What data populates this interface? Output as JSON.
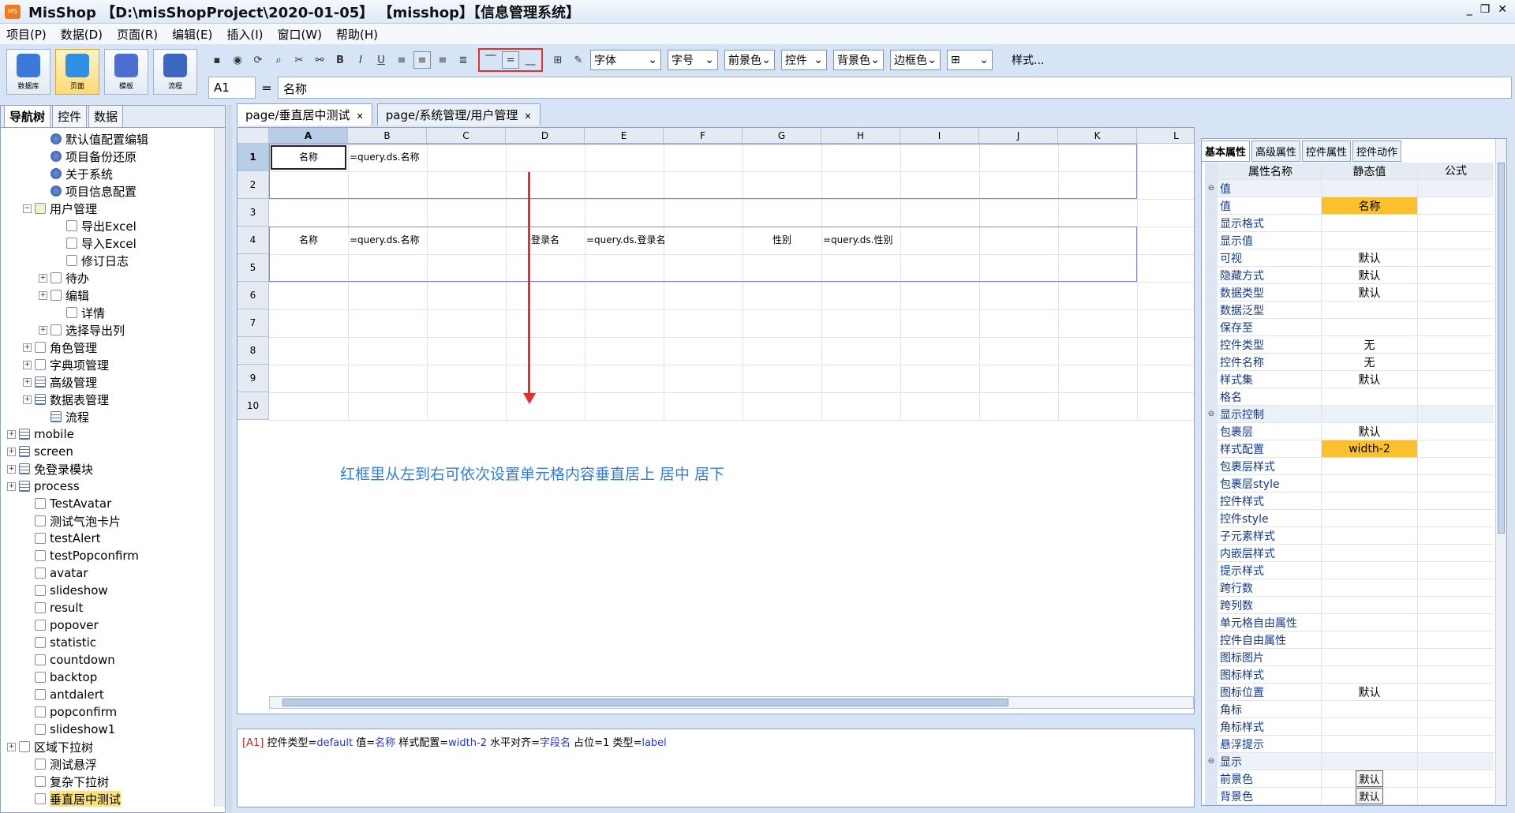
{
  "app": {
    "title": "MisShop 【D:\\misShopProject\\2020-01-05】 【misshop】【信息管理系统】",
    "min": "_",
    "max": "❐",
    "close": "✕"
  },
  "menu": [
    "项目(P)",
    "数据(D)",
    "页面(R)",
    "编辑(E)",
    "插入(I)",
    "窗口(W)",
    "帮助(H)"
  ],
  "bigbuttons": [
    {
      "label": "数据库",
      "color": "#3b7ad8"
    },
    {
      "label": "页面",
      "color": "#2f8fe0"
    },
    {
      "label": "模板",
      "color": "#4a6fd0"
    },
    {
      "label": "流程",
      "color": "#3a67c0"
    }
  ],
  "toolbar": {
    "font": "字体",
    "size": "字号",
    "fg": "前景色",
    "ctrl": "控件",
    "bg": "背景色",
    "border": "边框色",
    "style_label": "样式..."
  },
  "formula": {
    "cell": "A1",
    "eq": "=",
    "value": "名称"
  },
  "left_tabs": [
    "导航树",
    "控件",
    "数据"
  ],
  "tree": [
    {
      "indent": 2,
      "icon": "gear",
      "label": "默认值配置编辑",
      "tog": ""
    },
    {
      "indent": 2,
      "icon": "gear",
      "label": "项目备份还原",
      "tog": ""
    },
    {
      "indent": 2,
      "icon": "gear",
      "label": "关于系统",
      "tog": ""
    },
    {
      "indent": 2,
      "icon": "gear",
      "label": "项目信息配置",
      "tog": ""
    },
    {
      "indent": 1,
      "icon": "folder",
      "label": "用户管理",
      "tog": "−"
    },
    {
      "indent": 3,
      "icon": "page",
      "label": "导出Excel",
      "tog": ""
    },
    {
      "indent": 3,
      "icon": "page",
      "label": "导入Excel",
      "tog": ""
    },
    {
      "indent": 3,
      "icon": "page",
      "label": "修订日志",
      "tog": ""
    },
    {
      "indent": 2,
      "icon": "page",
      "label": "待办",
      "tog": "+"
    },
    {
      "indent": 2,
      "icon": "page",
      "label": "编辑",
      "tog": "+"
    },
    {
      "indent": 3,
      "icon": "page",
      "label": "详情",
      "tog": ""
    },
    {
      "indent": 2,
      "icon": "page",
      "label": "选择导出列",
      "tog": "+"
    },
    {
      "indent": 1,
      "icon": "page",
      "label": "角色管理",
      "tog": "+"
    },
    {
      "indent": 1,
      "icon": "page",
      "label": "字典项管理",
      "tog": "+"
    },
    {
      "indent": 1,
      "icon": "table",
      "label": "高级管理",
      "tog": "+"
    },
    {
      "indent": 1,
      "icon": "table",
      "label": "数据表管理",
      "tog": "+"
    },
    {
      "indent": 2,
      "icon": "table",
      "label": "流程",
      "tog": ""
    },
    {
      "indent": 0,
      "icon": "table",
      "label": "mobile",
      "tog": "+"
    },
    {
      "indent": 0,
      "icon": "table",
      "label": "screen",
      "tog": "+"
    },
    {
      "indent": 0,
      "icon": "table",
      "label": "免登录模块",
      "tog": "+"
    },
    {
      "indent": 0,
      "icon": "table",
      "label": "process",
      "tog": "+"
    },
    {
      "indent": 1,
      "icon": "page",
      "label": "TestAvatar",
      "tog": ""
    },
    {
      "indent": 1,
      "icon": "page",
      "label": "测试气泡卡片",
      "tog": ""
    },
    {
      "indent": 1,
      "icon": "page",
      "label": "testAlert",
      "tog": ""
    },
    {
      "indent": 1,
      "icon": "page",
      "label": "testPopconfirm",
      "tog": ""
    },
    {
      "indent": 1,
      "icon": "page",
      "label": "avatar",
      "tog": ""
    },
    {
      "indent": 1,
      "icon": "page",
      "label": "slideshow",
      "tog": ""
    },
    {
      "indent": 1,
      "icon": "page",
      "label": "result",
      "tog": ""
    },
    {
      "indent": 1,
      "icon": "page",
      "label": "popover",
      "tog": ""
    },
    {
      "indent": 1,
      "icon": "page",
      "label": "statistic",
      "tog": ""
    },
    {
      "indent": 1,
      "icon": "page",
      "label": "countdown",
      "tog": ""
    },
    {
      "indent": 1,
      "icon": "page",
      "label": "backtop",
      "tog": ""
    },
    {
      "indent": 1,
      "icon": "page",
      "label": "antdalert",
      "tog": ""
    },
    {
      "indent": 1,
      "icon": "page",
      "label": "popconfirm",
      "tog": ""
    },
    {
      "indent": 1,
      "icon": "page",
      "label": "slideshow1",
      "tog": ""
    },
    {
      "indent": 0,
      "icon": "page",
      "label": "区域下拉树",
      "tog": "+"
    },
    {
      "indent": 1,
      "icon": "page",
      "label": "测试悬浮",
      "tog": ""
    },
    {
      "indent": 1,
      "icon": "page",
      "label": "复杂下拉树",
      "tog": ""
    },
    {
      "indent": 1,
      "icon": "page",
      "label": "垂直居中测试",
      "tog": "",
      "selected": true
    }
  ],
  "doc_tabs": [
    {
      "label": "page/垂直居中测试",
      "active": true
    },
    {
      "label": "page/系统管理/用户管理",
      "active": false
    }
  ],
  "sheet": {
    "cols": [
      "A",
      "B",
      "C",
      "D",
      "E",
      "F",
      "G",
      "H",
      "I",
      "J",
      "K",
      "L"
    ],
    "rows": [
      "1",
      "2",
      "3",
      "4",
      "5",
      "6",
      "7",
      "8",
      "9",
      "10"
    ],
    "cells": [
      {
        "row": 1,
        "col": 0,
        "text": "名称",
        "center": true
      },
      {
        "row": 1,
        "col": 1,
        "text": "=query.ds.名称"
      },
      {
        "row": 4,
        "col": 0,
        "text": "名称",
        "center": true
      },
      {
        "row": 4,
        "col": 1,
        "text": "=query.ds.名称"
      },
      {
        "row": 4,
        "col": 3,
        "text": "登录名",
        "center": true
      },
      {
        "row": 4,
        "col": 4,
        "text": "=query.ds.登录名"
      },
      {
        "row": 4,
        "col": 6,
        "text": "性别",
        "center": true
      },
      {
        "row": 4,
        "col": 7,
        "text": "=query.ds.性别"
      }
    ]
  },
  "annotation": "红框里从左到右可依次设置单元格内容垂直居上 居中 居下",
  "message": {
    "ref": "[A1]",
    "t1": " 控件类型=",
    "v1": "default",
    "t2": " 值=",
    "v2": "名称",
    "t3": " 样式配置=",
    "v3": "width-2",
    "t4": " 水平对齐=",
    "v4": "字段名",
    "t5": " 占位=1 类型=",
    "v5": "label"
  },
  "right_tabs": [
    "基本属性",
    "高级属性",
    "控件属性",
    "控件动作"
  ],
  "props_header": {
    "name": "属性名称",
    "value": "静态值",
    "formula": "公式"
  },
  "props": [
    {
      "name": "值",
      "value": "",
      "group": true
    },
    {
      "name": "值",
      "value": "名称",
      "hl": true
    },
    {
      "name": "显示格式",
      "value": ""
    },
    {
      "name": "显示值",
      "value": ""
    },
    {
      "name": "可视",
      "value": "默认"
    },
    {
      "name": "隐藏方式",
      "value": "默认"
    },
    {
      "name": "数据类型",
      "value": "默认"
    },
    {
      "name": "数据泛型",
      "value": ""
    },
    {
      "name": "保存至",
      "value": ""
    },
    {
      "name": "控件类型",
      "value": "无"
    },
    {
      "name": "控件名称",
      "value": "无"
    },
    {
      "name": "样式集",
      "value": "默认"
    },
    {
      "name": "格名",
      "value": ""
    },
    {
      "name": "显示控制",
      "value": "",
      "group": true
    },
    {
      "name": "包裹层",
      "value": "默认"
    },
    {
      "name": "样式配置",
      "value": "width-2",
      "hl": true
    },
    {
      "name": "包裹层样式",
      "value": ""
    },
    {
      "name": "包裹层style",
      "value": ""
    },
    {
      "name": "控件样式",
      "value": ""
    },
    {
      "name": "控件style",
      "value": ""
    },
    {
      "name": "子元素样式",
      "value": ""
    },
    {
      "name": "内嵌层样式",
      "value": ""
    },
    {
      "name": "提示样式",
      "value": ""
    },
    {
      "name": "跨行数",
      "value": ""
    },
    {
      "name": "跨列数",
      "value": ""
    },
    {
      "name": "单元格自由属性",
      "value": ""
    },
    {
      "name": "控件自由属性",
      "value": ""
    },
    {
      "name": "图标图片",
      "value": ""
    },
    {
      "name": "图标样式",
      "value": ""
    },
    {
      "name": "图标位置",
      "value": "默认"
    },
    {
      "name": "角标",
      "value": ""
    },
    {
      "name": "角标样式",
      "value": ""
    },
    {
      "name": "悬浮提示",
      "value": ""
    },
    {
      "name": "显示",
      "value": "",
      "group": true
    },
    {
      "name": "前景色",
      "value": "默认",
      "box": true
    },
    {
      "name": "背景色",
      "value": "默认",
      "box": true
    }
  ]
}
